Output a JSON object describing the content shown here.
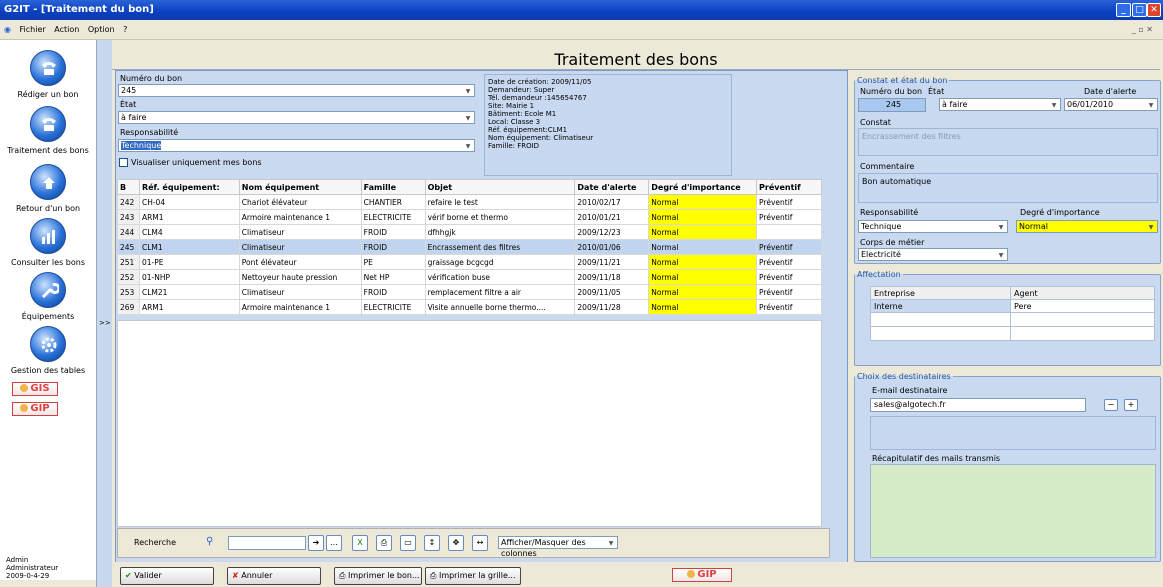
{
  "window": {
    "title": "G2IT - [Traitement du bon]"
  },
  "menu": [
    "Fichier",
    "Action",
    "Option",
    "?"
  ],
  "sidebar": {
    "items": [
      {
        "label": "Rédiger un bon"
      },
      {
        "label": "Traitement des bons"
      },
      {
        "label": "Retour d'un bon"
      },
      {
        "label": "Consulter les bons"
      },
      {
        "label": "Équipements"
      },
      {
        "label": "Gestion des tables"
      }
    ],
    "badges": [
      "GIS",
      "GIP"
    ],
    "user": {
      "name": "Admin",
      "role": "Administrateur",
      "date": "2009-0-4-29"
    }
  },
  "page_title": "Traitement des bons",
  "filters": {
    "numero_label": "Numéro du bon",
    "numero_value": "245",
    "etat_label": "État",
    "etat_value": "à faire",
    "resp_label": "Responsabilité",
    "resp_value": "Technique",
    "checkbox_label": "Visualiser uniquement mes bons"
  },
  "info": [
    "Date de création: 2009/11/05",
    "Demandeur: Super",
    "Tél. demandeur :145654767",
    "Site: Mairie 1",
    "Bâtiment: Ecole M1",
    "Local: Classe 3",
    "Réf. équipement:CLM1",
    "Nom équipement: Climatiseur",
    "Famille: FROID"
  ],
  "grid": {
    "columns": [
      "B",
      "Réf. équipement:",
      "Nom équipement",
      "Famille",
      "Objet",
      "Date d'alerte",
      "Degré d'importance",
      "Préventif"
    ],
    "rows": [
      [
        "242",
        "CH-04",
        "Chariot élévateur",
        "CHANTIER",
        "refaire le test",
        "2010/02/17",
        "Normal",
        "Préventif"
      ],
      [
        "243",
        "ARM1",
        "Armoire maintenance 1",
        "ELECTRICITE",
        "vérif borne et thermo",
        "2010/01/21",
        "Normal",
        "Préventif"
      ],
      [
        "244",
        "CLM4",
        "Climatiseur",
        "FROID",
        "dfhhgjk",
        "2009/12/23",
        "Normal",
        ""
      ],
      [
        "245",
        "CLM1",
        "Climatiseur",
        "FROID",
        "Encrassement des filtres",
        "2010/01/06",
        "Normal",
        "Préventif"
      ],
      [
        "251",
        "01-PE",
        "Pont élévateur",
        "PE",
        "graissage bcgcgd",
        "2009/11/21",
        "Normal",
        "Préventif"
      ],
      [
        "252",
        "01-NHP",
        "Nettoyeur haute pression",
        "Net HP",
        "vérification buse",
        "2009/11/18",
        "Normal",
        "Préventif"
      ],
      [
        "253",
        "CLM21",
        "Climatiseur",
        "FROID",
        "remplacement filtre a air",
        "2009/11/05",
        "Normal",
        "Préventif"
      ],
      [
        "269",
        "ARM1",
        "Armoire maintenance 1",
        "ELECTRICITE",
        "Visite annuelle borne thermo....",
        "2009/11/28",
        "Normal",
        "Préventif"
      ]
    ],
    "selected_row": 3
  },
  "toolbar": {
    "search_label": "Recherche",
    "columns_label": "Afficher/Masquer des colonnes"
  },
  "buttons": {
    "valider": "Valider",
    "annuler": "Annuler",
    "imprimer_bon": "Imprimer le bon...",
    "imprimer_grille": "Imprimer la grille...",
    "gip": "GIP"
  },
  "constat": {
    "legend": "Constat et état du bon",
    "numero_label": "Numéro du bon",
    "numero_value": "245",
    "etat_label": "État",
    "etat_value": "à faire",
    "alerte_label": "Date d'alerte",
    "alerte_value": "06/01/2010",
    "constat_label": "Constat",
    "constat_value": "Encrassement des filtres",
    "commentaire_label": "Commentaire",
    "commentaire_value": "Bon automatique",
    "resp_label": "Responsabilité",
    "resp_value": "Technique",
    "degre_label": "Degré d'importance",
    "degre_value": "Normal",
    "corps_label": "Corps de métier",
    "corps_value": "Electricité"
  },
  "affectation": {
    "legend": "Affectation",
    "columns": [
      "Entreprise",
      "Agent"
    ],
    "rows": [
      [
        "Interne",
        "Pere"
      ]
    ]
  },
  "destinataires": {
    "legend": "Choix des destinataires",
    "email_label": "E-mail destinataire",
    "email_value": "sales@algotech.fr",
    "recap_label": "Récapitulatif des mails transmis"
  }
}
